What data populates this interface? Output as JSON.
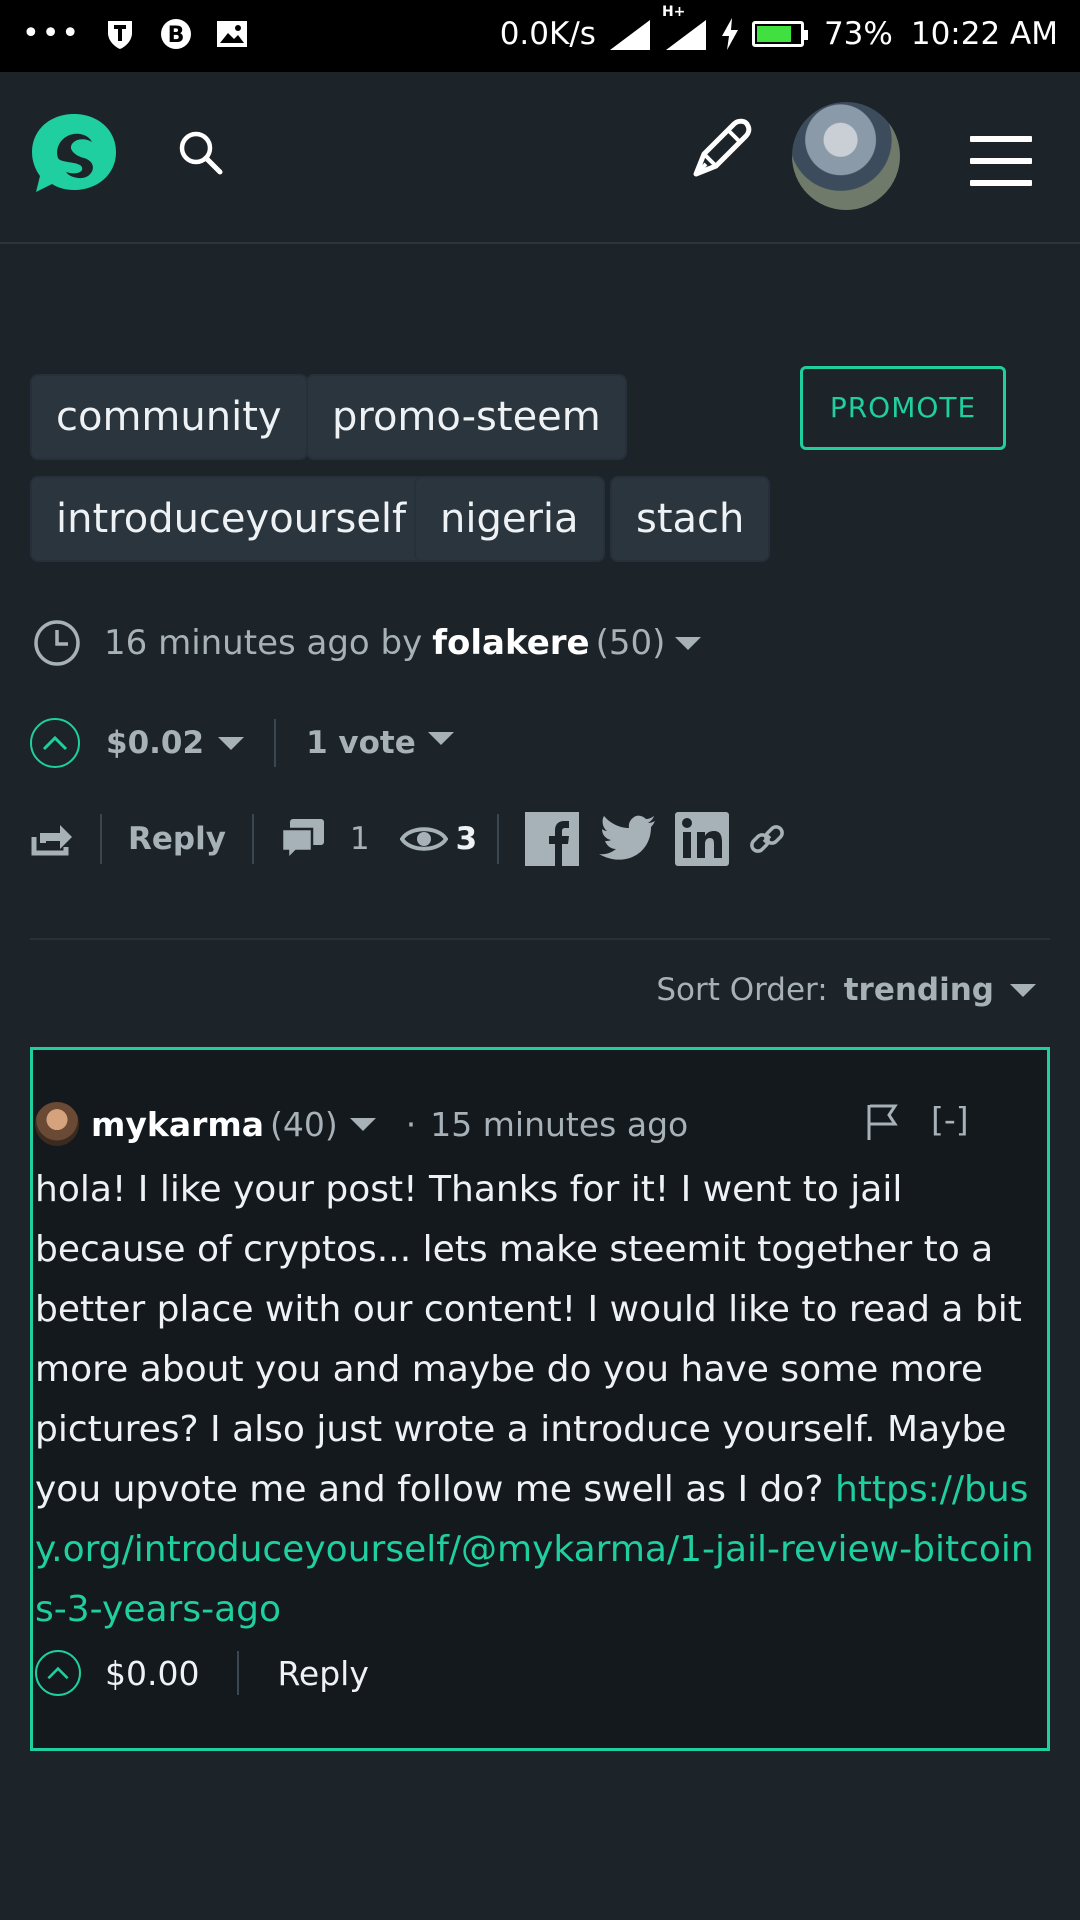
{
  "status_bar": {
    "net_speed": "0.0K/s",
    "net_type": "H+",
    "battery_percent": "73%",
    "battery_level": 0.73,
    "time": "10:22 AM"
  },
  "header": {
    "logo_icon": "steemit-logo-icon",
    "search_icon": "search-icon",
    "write_icon": "pencil-icon",
    "menu_icon": "hamburger-menu-icon",
    "accent_color": "#1fcfa0"
  },
  "tags": [
    "community",
    "promo-steem",
    "introduceyourself",
    "nigeria",
    "stach"
  ],
  "promote_label": "PROMOTE",
  "post_meta": {
    "time_ago": "16 minutes ago by",
    "author": "folakere",
    "reputation": "(50)"
  },
  "votes": {
    "payout": "$0.02",
    "vote_count": "1 vote"
  },
  "actions": {
    "reply_label": "Reply",
    "comment_count": "1",
    "view_count": "3"
  },
  "sort": {
    "label": "Sort Order:",
    "value": "trending"
  },
  "comment": {
    "author": "mykarma",
    "reputation": "(40)",
    "separator": "·",
    "time_ago": "15 minutes ago",
    "collapse_label": "[-]",
    "body": "hola! I like your post! Thanks for it! I went to jail because of cryptos... lets make steemit together to a better place with our content! I would like to read a bit more about you and maybe do you have some more pictures? I also just wrote a introduce yourself. Maybe you upvote me and follow me swell as I do?",
    "link": "https://busy.org/introduceyourself/@mykarma/1-jail-review-bitcoins-3-years-ago",
    "payout": "$0.00",
    "reply_label": "Reply"
  }
}
